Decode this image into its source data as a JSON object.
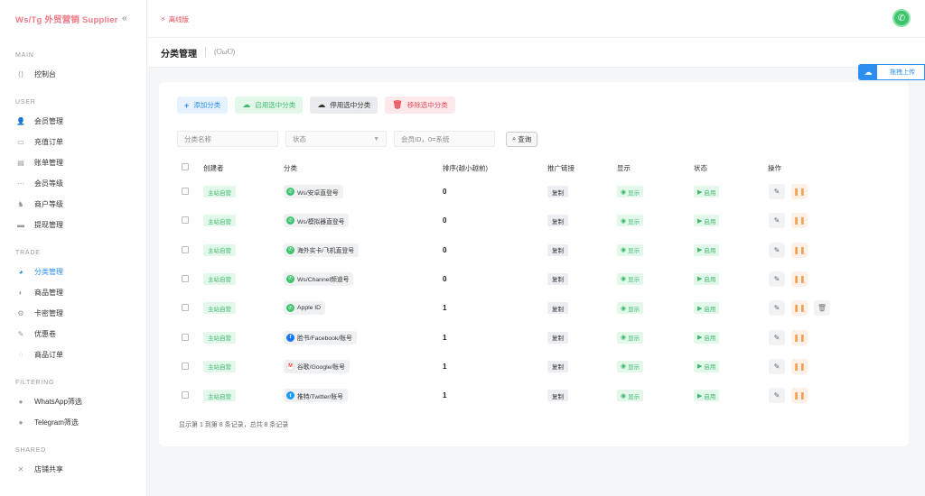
{
  "brand": {
    "name": "Ws/Tg 外贸营销 Supplier",
    "collapse_glyph": "«"
  },
  "sidebar": {
    "sections": [
      {
        "title": "MAIN",
        "items": [
          {
            "label": "控制台",
            "icon": "code-icon",
            "active": false
          }
        ]
      },
      {
        "title": "USER",
        "items": [
          {
            "label": "会员管理",
            "icon": "user-icon",
            "active": false
          },
          {
            "label": "充值订单",
            "icon": "card-icon",
            "active": false
          },
          {
            "label": "账单管理",
            "icon": "bill-icon",
            "active": false
          },
          {
            "label": "会员等级",
            "icon": "share-icon",
            "active": false
          },
          {
            "label": "商户等级",
            "icon": "merchant-icon",
            "active": false
          },
          {
            "label": "提现管理",
            "icon": "withdraw-icon",
            "active": false
          }
        ]
      },
      {
        "title": "TRADE",
        "items": [
          {
            "label": "分类管理",
            "icon": "pie-icon",
            "active": true
          },
          {
            "label": "商品管理",
            "icon": "goods-icon",
            "active": false
          },
          {
            "label": "卡密管理",
            "icon": "key-icon",
            "active": false
          },
          {
            "label": "优惠卷",
            "icon": "coupon-icon",
            "active": false
          },
          {
            "label": "商品订单",
            "icon": "order-icon",
            "active": false
          }
        ]
      },
      {
        "title": "FILTERING",
        "items": [
          {
            "label": "WhatsApp筛选",
            "icon": "filter-icon",
            "active": false
          },
          {
            "label": "Telegram筛选",
            "icon": "filter-icon",
            "active": false
          }
        ]
      },
      {
        "title": "SHARED",
        "items": [
          {
            "label": "店铺共享",
            "icon": "cross-icon",
            "active": false
          }
        ]
      }
    ]
  },
  "topbar": {
    "status": "离线版"
  },
  "page": {
    "title": "分类管理",
    "face": "(ᗜωᗜ)"
  },
  "upload": {
    "label": "拖拽上传"
  },
  "toolbar": {
    "add": "添加分类",
    "enable": "启用选中分类",
    "disable": "停用选中分类",
    "remove": "移除选中分类"
  },
  "filters": {
    "name_placeholder": "分类名称",
    "status_placeholder": "状态",
    "member_placeholder": "会员ID，0=系统",
    "query": "查询"
  },
  "table": {
    "headers": {
      "creator": "创建者",
      "category": "分类",
      "sort": "排序(越小越前)",
      "promo": "推广链接",
      "display": "显示",
      "status": "状态",
      "actions": "操作"
    },
    "rows": [
      {
        "creator": "主站自营",
        "category": "Ws/安卓直登号",
        "brand": "whatsapp",
        "sort": "0",
        "copy": "复制",
        "display": "显示",
        "status": "启用",
        "delete": false
      },
      {
        "creator": "主站自营",
        "category": "Ws/模拟器直登号",
        "brand": "whatsapp",
        "sort": "0",
        "copy": "复制",
        "display": "显示",
        "status": "启用",
        "delete": false
      },
      {
        "creator": "主站自营",
        "category": "海外实卡/飞机直登号",
        "brand": "whatsapp",
        "sort": "0",
        "copy": "复制",
        "display": "显示",
        "status": "启用",
        "delete": false
      },
      {
        "creator": "主站自营",
        "category": "Ws/Channel频道号",
        "brand": "whatsapp",
        "sort": "0",
        "copy": "复制",
        "display": "显示",
        "status": "启用",
        "delete": false
      },
      {
        "creator": "主站自营",
        "category": "Apple ID",
        "brand": "whatsapp",
        "sort": "1",
        "copy": "复制",
        "display": "显示",
        "status": "启用",
        "delete": true
      },
      {
        "creator": "主站自营",
        "category": "脸书/Facebook/账号",
        "brand": "facebook",
        "sort": "1",
        "copy": "复制",
        "display": "显示",
        "status": "启用",
        "delete": false
      },
      {
        "creator": "主站自营",
        "category": "谷歌/Google/账号",
        "brand": "google",
        "sort": "1",
        "copy": "复制",
        "display": "显示",
        "status": "启用",
        "delete": false
      },
      {
        "creator": "主站自营",
        "category": "推特/Twitter/账号",
        "brand": "twitter",
        "sort": "1",
        "copy": "复制",
        "display": "显示",
        "status": "启用",
        "delete": false
      }
    ]
  },
  "footer": {
    "info": "显示第 1 到第 8 条记录，总共 8 条记录"
  },
  "colors": {
    "accent": "#2b8ff0",
    "success": "#3dbb6d",
    "danger": "#e74c5a",
    "brand": "#f07a8a"
  }
}
